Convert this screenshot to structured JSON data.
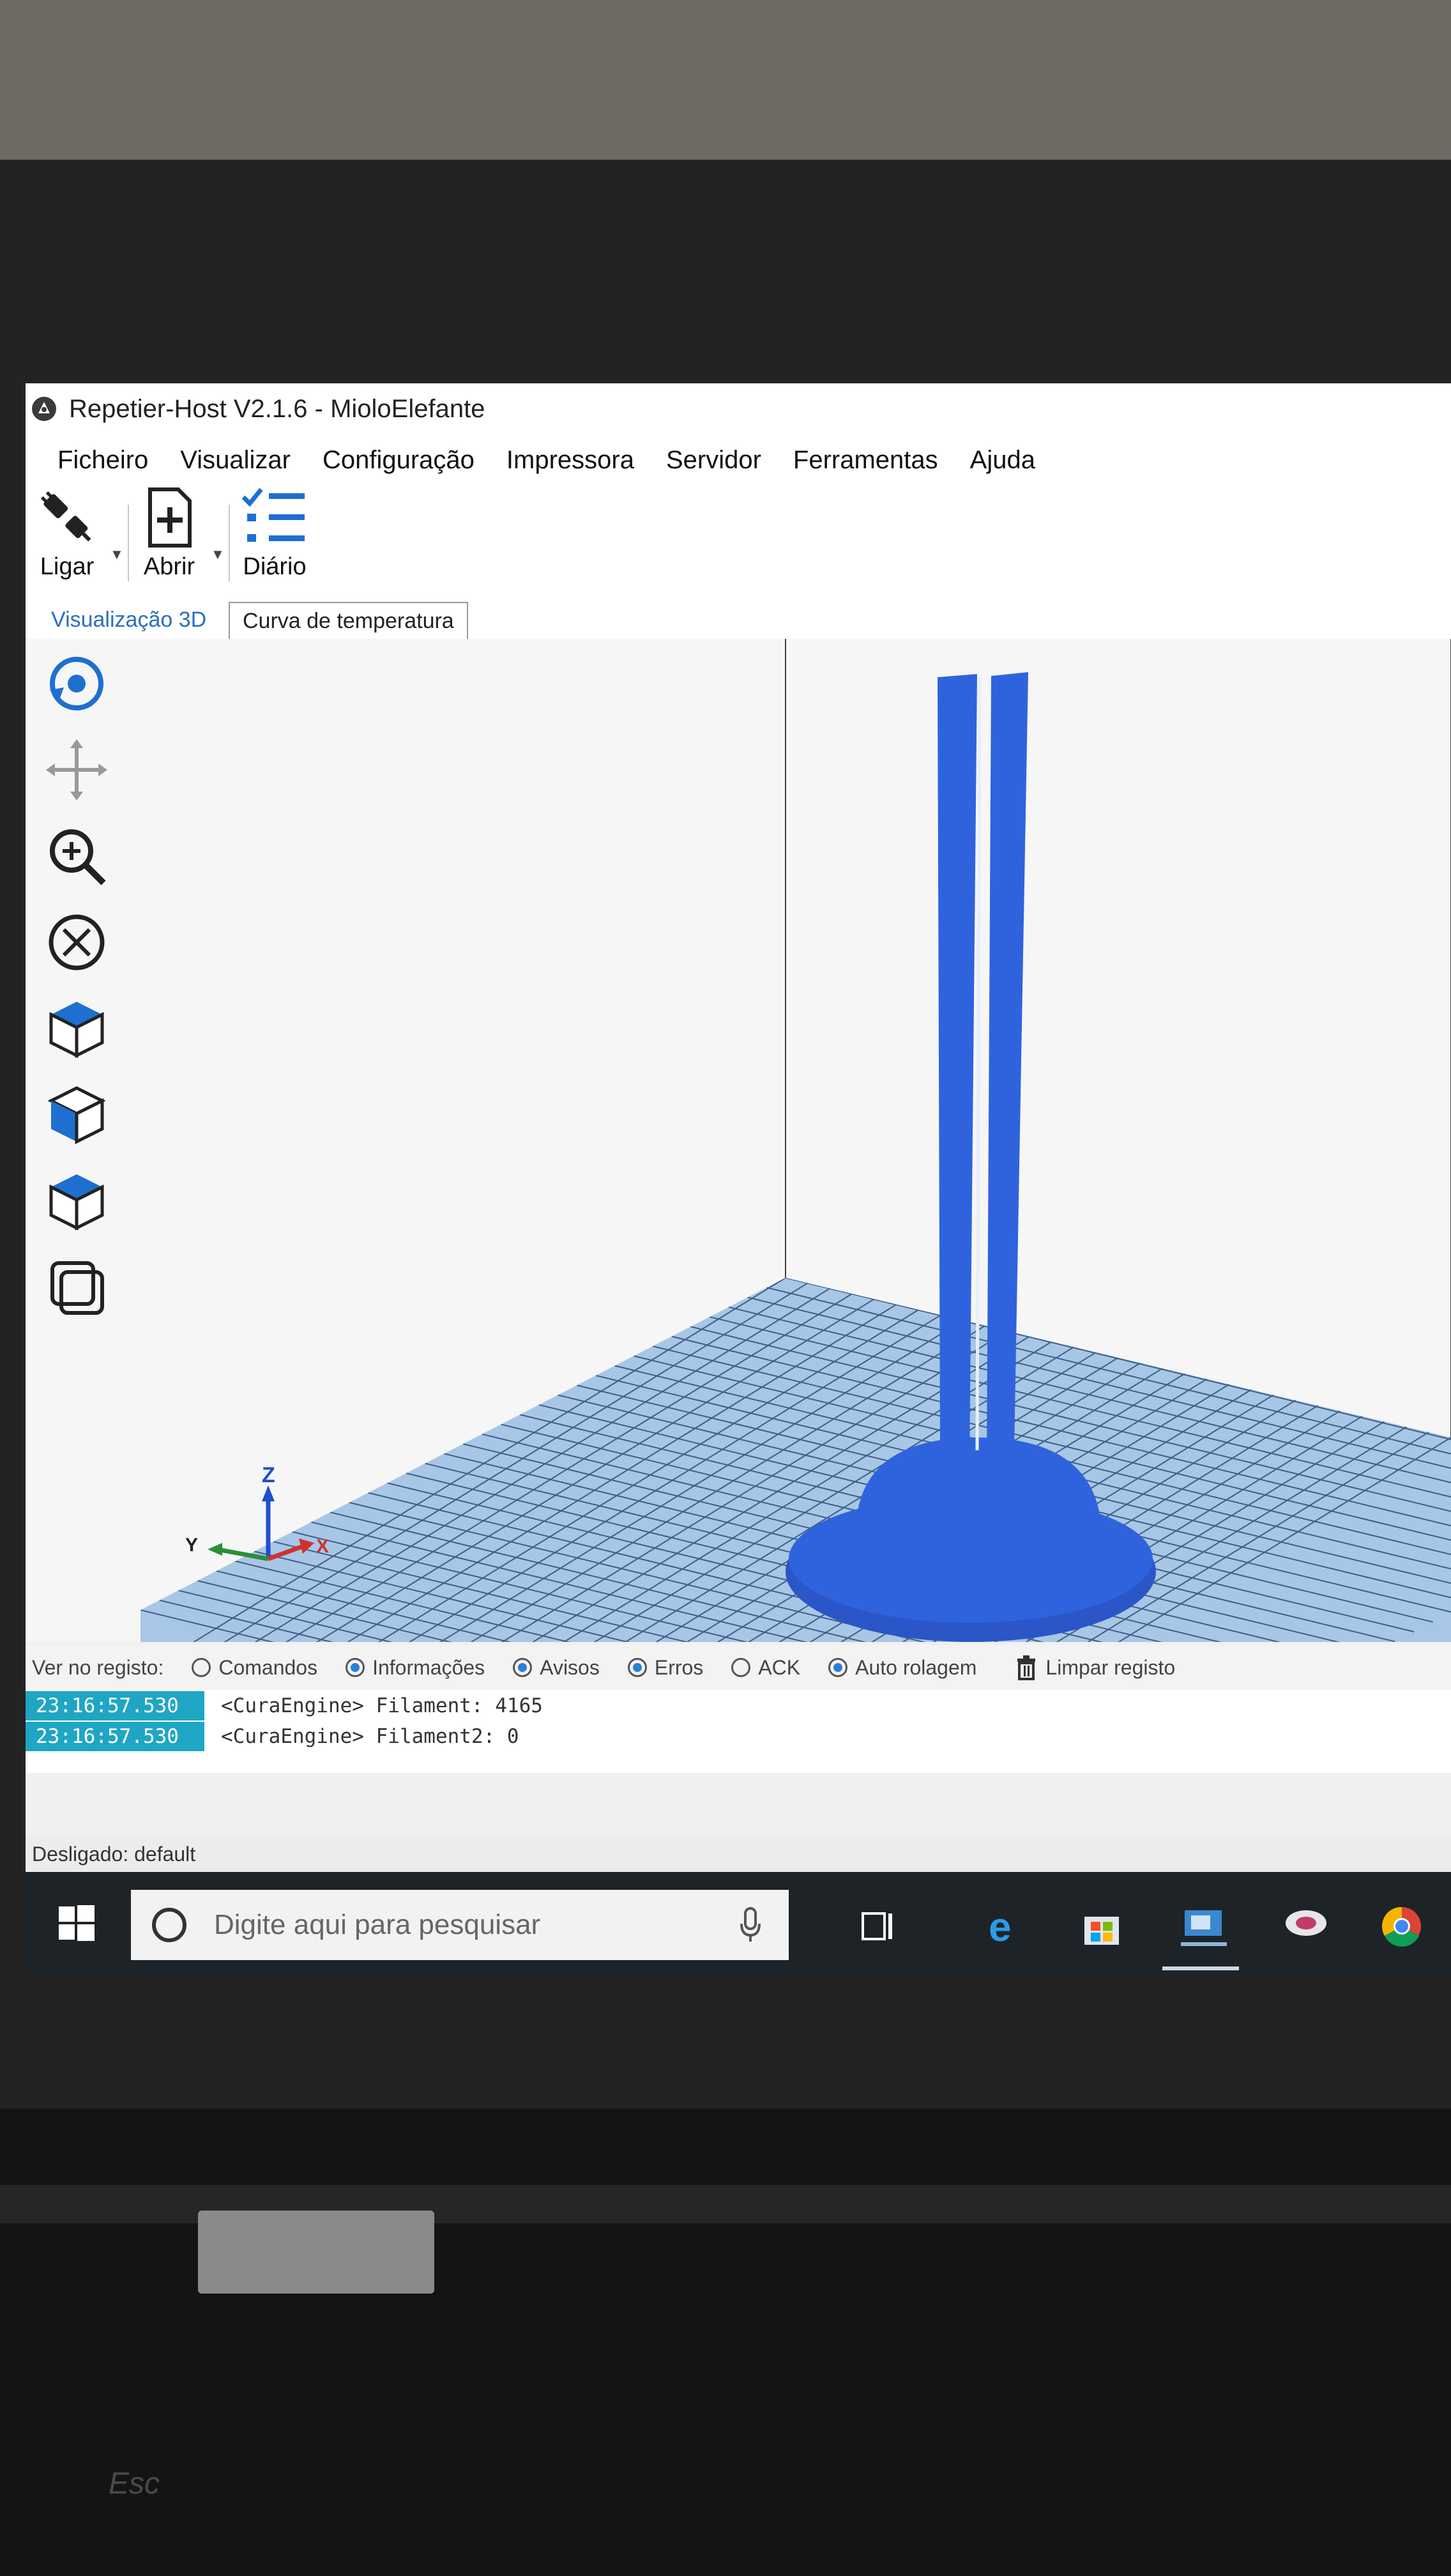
{
  "window": {
    "title": "Repetier-Host V2.1.6 - MioloElefante"
  },
  "menu": [
    "Ficheiro",
    "Visualizar",
    "Configuração",
    "Impressora",
    "Servidor",
    "Ferramentas",
    "Ajuda"
  ],
  "toolbar": {
    "connect_label": "Ligar",
    "open_label": "Abrir",
    "log_label": "Diário"
  },
  "tabs": {
    "view3d": "Visualização 3D",
    "temp_curve": "Curva de temperatura"
  },
  "axes": {
    "x": "X",
    "y": "Y",
    "z": "Z"
  },
  "log_filter": {
    "label": "Ver no registo:",
    "options": [
      {
        "label": "Comandos",
        "checked": false
      },
      {
        "label": "Informações",
        "checked": true
      },
      {
        "label": "Avisos",
        "checked": true
      },
      {
        "label": "Erros",
        "checked": true
      },
      {
        "label": "ACK",
        "checked": false
      },
      {
        "label": "Auto rolagem",
        "checked": true
      }
    ],
    "clear_label": "Limpar registo"
  },
  "log_entries": [
    {
      "time": "23:16:57.530",
      "message": "<CuraEngine> Filament: 4165"
    },
    {
      "time": "23:16:57.530",
      "message": "<CuraEngine> Filament2: 0"
    }
  ],
  "status": "Desligado: default",
  "taskbar": {
    "search_placeholder": "Digite aqui para pesquisar"
  },
  "keyboard": {
    "esc": "Esc"
  },
  "colors": {
    "model": "#2f63de",
    "bed": "#a8c6e6",
    "grid_line": "#3d5f86",
    "timestamp_bg": "#1fa6c4",
    "accent": "#2a7fd8"
  }
}
